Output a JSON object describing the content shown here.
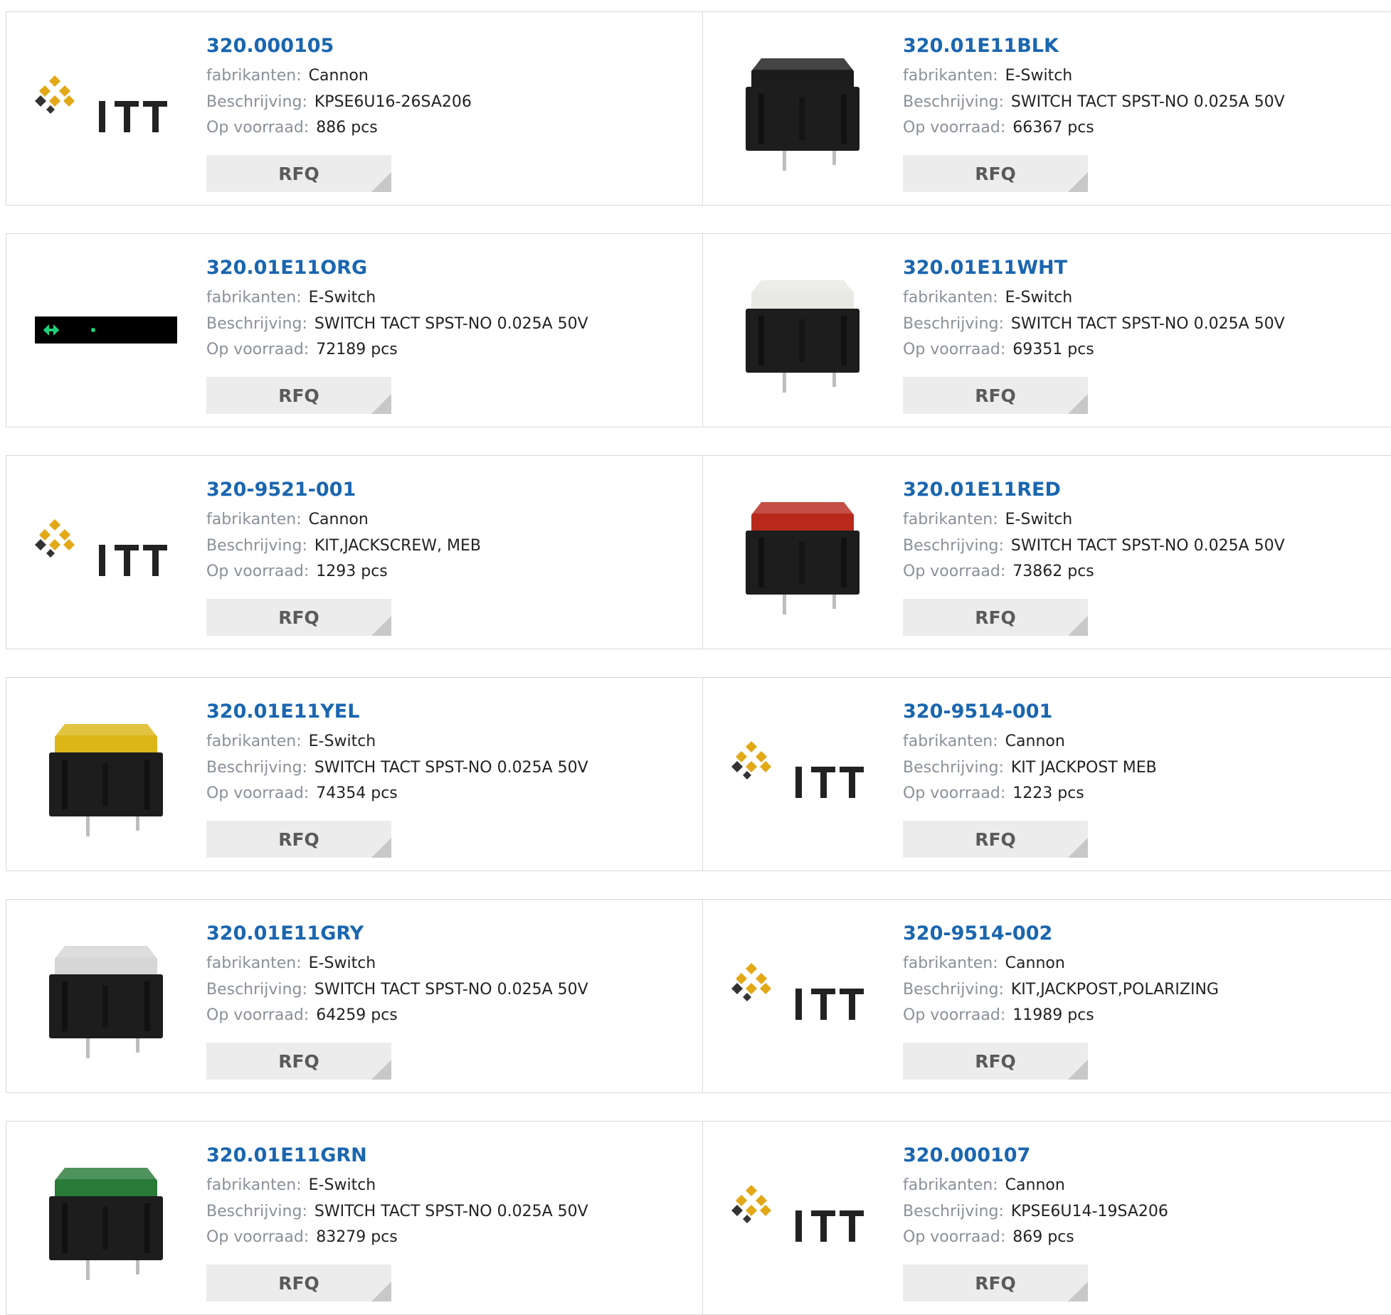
{
  "labels": {
    "manufacturer": "fabrikanten:",
    "description": "Beschrijving:",
    "stock": "Op voorraad:",
    "rfq": "RFQ"
  },
  "products": [
    {
      "part": "320.000105",
      "manufacturer": "Cannon",
      "description": "KPSE6U16-26SA206",
      "stock": "886 pcs",
      "image": "itt-logo"
    },
    {
      "part": "320.01E11BLK",
      "manufacturer": "E-Switch",
      "description": "SWITCH TACT SPST-NO 0.025A 50V",
      "stock": "66367 pcs",
      "image": "switch",
      "cap_color": "#1c1c1c"
    },
    {
      "part": "320.01E11ORG",
      "manufacturer": "E-Switch",
      "description": "SWITCH TACT SPST-NO 0.025A 50V",
      "stock": "72189 pcs",
      "image": "broken-image-strip"
    },
    {
      "part": "320.01E11WHT",
      "manufacturer": "E-Switch",
      "description": "SWITCH TACT SPST-NO 0.025A 50V",
      "stock": "69351 pcs",
      "image": "switch",
      "cap_color": "#e8e8e4"
    },
    {
      "part": "320-9521-001",
      "manufacturer": "Cannon",
      "description": "KIT,JACKSCREW, MEB",
      "stock": "1293 pcs",
      "image": "itt-logo"
    },
    {
      "part": "320.01E11RED",
      "manufacturer": "E-Switch",
      "description": "SWITCH TACT SPST-NO 0.025A 50V",
      "stock": "73862 pcs",
      "image": "switch",
      "cap_color": "#b8291c"
    },
    {
      "part": "320.01E11YEL",
      "manufacturer": "E-Switch",
      "description": "SWITCH TACT SPST-NO 0.025A 50V",
      "stock": "74354 pcs",
      "image": "switch",
      "cap_color": "#dcb619"
    },
    {
      "part": "320-9514-001",
      "manufacturer": "Cannon",
      "description": "KIT JACKPOST MEB",
      "stock": "1223 pcs",
      "image": "itt-logo"
    },
    {
      "part": "320.01E11GRY",
      "manufacturer": "E-Switch",
      "description": "SWITCH TACT SPST-NO 0.025A 50V",
      "stock": "64259 pcs",
      "image": "switch",
      "cap_color": "#d6d6d6"
    },
    {
      "part": "320-9514-002",
      "manufacturer": "Cannon",
      "description": "KIT,JACKPOST,POLARIZING",
      "stock": "11989 pcs",
      "image": "itt-logo"
    },
    {
      "part": "320.01E11GRN",
      "manufacturer": "E-Switch",
      "description": "SWITCH TACT SPST-NO 0.025A 50V",
      "stock": "83279 pcs",
      "image": "switch",
      "cap_color": "#2a7a3a"
    },
    {
      "part": "320.000107",
      "manufacturer": "Cannon",
      "description": "KPSE6U14-19SA206",
      "stock": "869 pcs",
      "image": "itt-logo"
    }
  ],
  "colors": {
    "part_link": "#1a66b0",
    "label": "#8a9097",
    "value": "#222222",
    "rfq_bg": "#ececec",
    "itt_gold": "#e3a816"
  }
}
